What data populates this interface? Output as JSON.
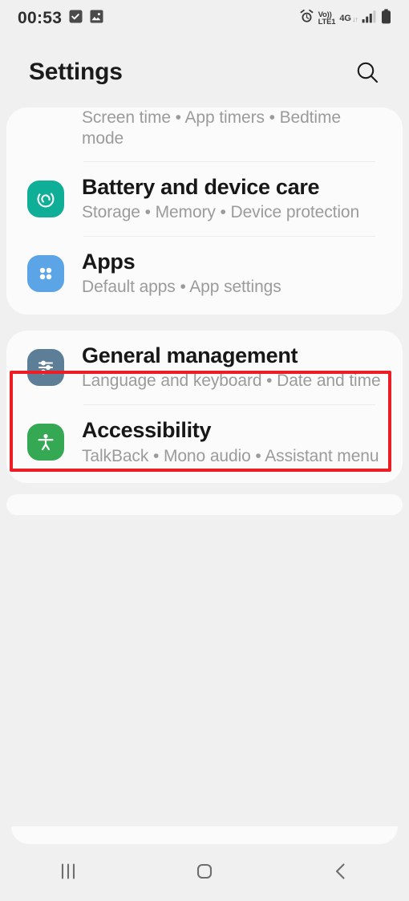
{
  "status_bar": {
    "time": "00:53",
    "left_icons": [
      "checkmark-badge-icon",
      "image-icon"
    ],
    "alarm_icon": "alarm-clock-icon",
    "volte_line1": "Vo))",
    "volte_line2": "LTE1",
    "network_type": "4G",
    "data_arrows": "↓↑",
    "signal_icon": "signal-bars-icon",
    "battery_icon": "battery-full-icon"
  },
  "header": {
    "title": "Settings",
    "search_icon": "search-icon"
  },
  "colors": {
    "page_background": "#f0f0f0",
    "card_background": "#fbfbfb",
    "title_text": "#171717",
    "subtitle_text": "#9b9b9b",
    "highlight_border": "#ee1c25",
    "icon_battery": "#0fae96",
    "icon_apps": "#5ba4e5",
    "icon_general": "#5c7e96",
    "icon_accessibility": "#34a853"
  },
  "cards": [
    {
      "name": "card-digital-wellbeing",
      "rows": [
        {
          "name": "row-digital-wellbeing",
          "clipped": true,
          "title": "",
          "subtitle": "Screen time  •  App timers  •  Bedtime mode",
          "icon": "",
          "icon_color": "",
          "divider_after": true
        },
        {
          "name": "row-battery-and-device-care",
          "clipped": false,
          "title": "Battery and device care",
          "subtitle": "Storage  •  Memory  •  Device protection",
          "icon": "device-care-icon",
          "icon_color": "#0fae96",
          "divider_after": true
        },
        {
          "name": "row-apps",
          "clipped": false,
          "title": "Apps",
          "subtitle": "Default apps  •  App settings",
          "icon": "apps-grid-icon",
          "icon_color": "#5ba4e5",
          "divider_after": false,
          "highlighted": true
        }
      ]
    },
    {
      "name": "card-general",
      "rows": [
        {
          "name": "row-general-management",
          "clipped": false,
          "title": "General management",
          "subtitle": "Language and keyboard  •  Date and time",
          "icon": "sliders-icon",
          "icon_color": "#5c7e96",
          "divider_after": true
        },
        {
          "name": "row-accessibility",
          "clipped": false,
          "title": "Accessibility",
          "subtitle": "TalkBack  •  Mono audio  •  Assistant menu",
          "icon": "accessibility-person-icon",
          "icon_color": "#34a853",
          "divider_after": false
        }
      ]
    }
  ],
  "navigation_bar": {
    "recents_label": "recents-icon",
    "home_label": "home-icon",
    "back_label": "back-icon"
  }
}
